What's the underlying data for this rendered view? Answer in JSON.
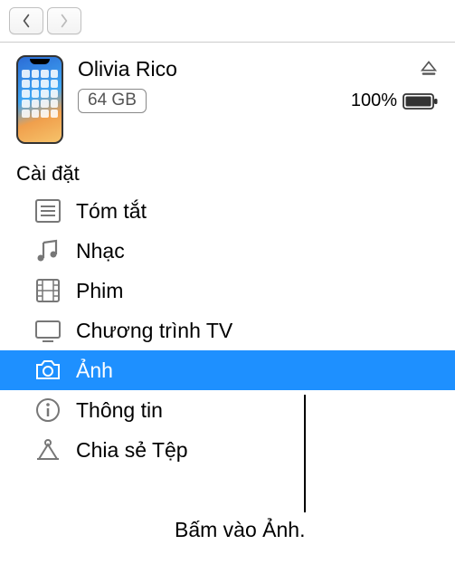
{
  "nav": {
    "back": "back",
    "forward": "forward"
  },
  "device": {
    "name": "Olivia Rico",
    "storage": "64 GB",
    "battery_percent": "100%"
  },
  "section_header": "Cài đặt",
  "items": [
    {
      "label": "Tóm tắt",
      "icon": "summary"
    },
    {
      "label": "Nhạc",
      "icon": "music"
    },
    {
      "label": "Phim",
      "icon": "movies"
    },
    {
      "label": "Chương trình TV",
      "icon": "tv"
    },
    {
      "label": "Ảnh",
      "icon": "photos",
      "selected": true
    },
    {
      "label": "Thông tin",
      "icon": "info"
    },
    {
      "label": "Chia sẻ Tệp",
      "icon": "fileshare"
    }
  ],
  "callout": "Bấm vào Ảnh."
}
